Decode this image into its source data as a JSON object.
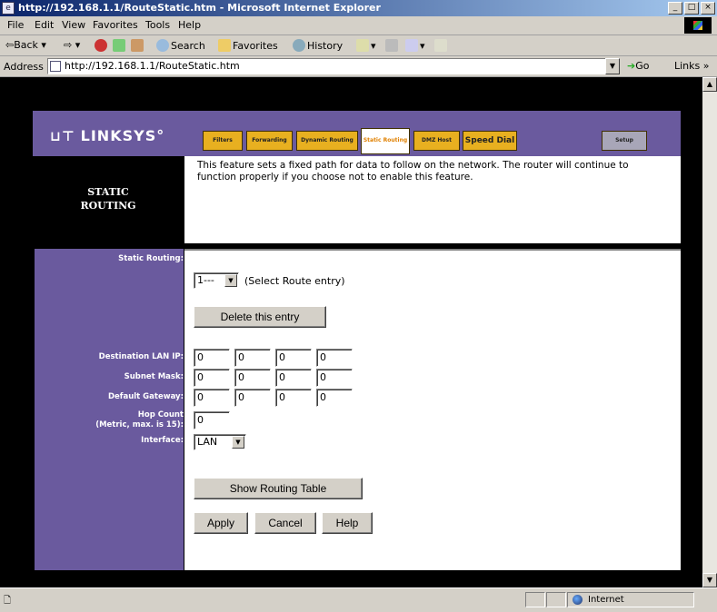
{
  "window": {
    "title": "http://192.168.1.1/RouteStatic.htm - Microsoft Internet Explorer"
  },
  "menu": [
    "File",
    "Edit",
    "View",
    "Favorites",
    "Tools",
    "Help"
  ],
  "toolbar": {
    "back": "Back",
    "search": "Search",
    "favorites": "Favorites",
    "history": "History"
  },
  "address": {
    "label": "Address",
    "url": "http://192.168.1.1/RouteStatic.htm",
    "go": "Go",
    "links": "Links »"
  },
  "brand": {
    "logo": "LINKSYS"
  },
  "tabs": [
    {
      "label": "Filters",
      "active": false
    },
    {
      "label": "Forwarding",
      "active": false
    },
    {
      "label": "Dynamic Routing",
      "active": false
    },
    {
      "label": "Static Routing",
      "active": true
    },
    {
      "label": "DMZ Host",
      "active": false
    },
    {
      "label": "Speed Dial",
      "active": false
    },
    {
      "label": "Setup",
      "active": false
    }
  ],
  "section": {
    "title_line1": "STATIC",
    "title_line2": "ROUTING",
    "description": "This feature sets a fixed path for data to follow on the network. The router will continue to function properly if you choose not to enable this feature."
  },
  "form": {
    "static_routing_label": "Static Routing:",
    "route_entry_value": "1---",
    "route_entry_hint": "(Select Route entry)",
    "delete_button": "Delete this entry",
    "dest_ip_label": "Destination LAN IP:",
    "dest_ip": [
      "0",
      "0",
      "0",
      "0"
    ],
    "subnet_label": "Subnet Mask:",
    "subnet": [
      "0",
      "0",
      "0",
      "0"
    ],
    "gateway_label": "Default Gateway:",
    "gateway": [
      "0",
      "0",
      "0",
      "0"
    ],
    "hop_label_line1": "Hop Count",
    "hop_label_line2": "(Metric, max. is 15):",
    "hop_count": "0",
    "interface_label": "Interface:",
    "interface_value": "LAN",
    "show_table_button": "Show Routing Table",
    "apply_button": "Apply",
    "cancel_button": "Cancel",
    "help_button": "Help"
  },
  "status": {
    "zone": "Internet"
  }
}
